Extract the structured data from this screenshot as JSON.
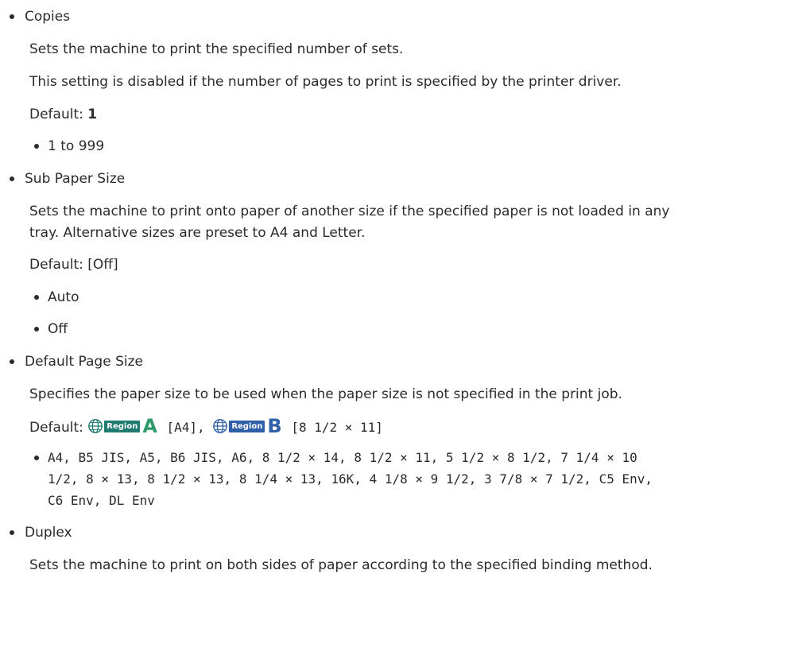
{
  "sections": [
    {
      "title": "Copies",
      "paragraphs": [
        "Sets the machine to print the specified number of sets.",
        "This setting is disabled if the number of pages to print is specified by the printer driver."
      ],
      "default_label": "Default: ",
      "default_value": "1",
      "options": [
        "1 to 999"
      ]
    },
    {
      "title": "Sub Paper Size",
      "paragraphs": [
        "Sets the machine to print onto paper of another size if the specified paper is not loaded in any",
        "tray. Alternative sizes are preset to A4 and Letter."
      ],
      "default_label": "Default: [Off]",
      "options": [
        "Auto",
        "Off"
      ]
    },
    {
      "title": "Default Page Size",
      "paragraphs": [
        "Specifies the paper size to be used when the paper size is not specified in the print job."
      ],
      "default_label": "Default: ",
      "region_text": "Region",
      "region_a_letter": "A",
      "region_a_value": " [A4], ",
      "region_b_letter": "B",
      "region_b_value": " [8 1/2 × 11]",
      "options_lines": [
        "A4, B5 JIS, A5, B6 JIS, A6, 8 1/2 × 14, 8 1/2 × 11, 5 1/2 × 8 1/2, 7 1/4 × 10",
        "1/2, 8 × 13, 8 1/2 × 13, 8 1/4 × 13, 16K, 4 1/8 × 9 1/2, 3 7/8 × 7 1/2, C5 Env,",
        "C6 Env, DL Env"
      ]
    },
    {
      "title": "Duplex",
      "paragraphs": [
        "Sets the machine to print on both sides of paper according to the specified binding method."
      ]
    }
  ],
  "colors": {
    "text": "#2b2b2b",
    "region_a_box": "#1f7a72",
    "region_a_letter": "#2f9a6a",
    "region_b": "#2f5fa8"
  }
}
